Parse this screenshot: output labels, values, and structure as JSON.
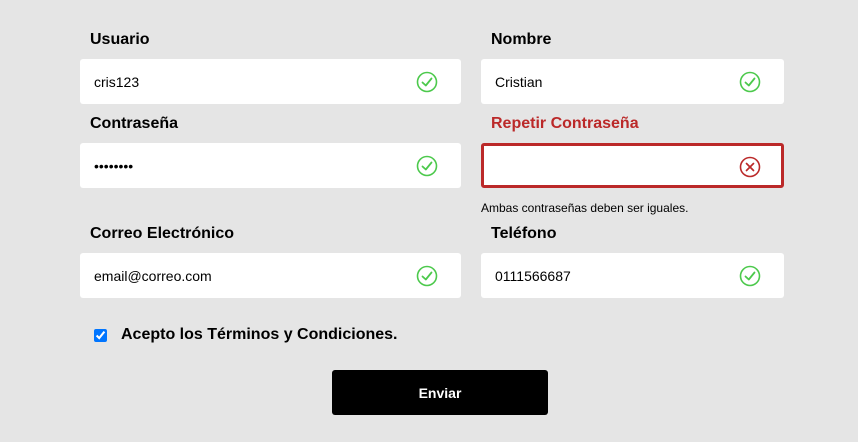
{
  "form": {
    "usuario": {
      "label": "Usuario",
      "value": "cris123",
      "status": "valid"
    },
    "nombre": {
      "label": "Nombre",
      "value": "Cristian",
      "status": "valid"
    },
    "password": {
      "label": "Contraseña",
      "value": "••••••••",
      "status": "valid"
    },
    "password2": {
      "label": "Repetir Contraseña",
      "value": "",
      "status": "invalid",
      "error": "Ambas contraseñas deben ser iguales."
    },
    "correo": {
      "label": "Correo Electrónico",
      "value": "email@correo.com",
      "status": "valid"
    },
    "telefono": {
      "label": "Teléfono",
      "value": "0111566687",
      "status": "valid"
    },
    "terms_label": "Acepto los Términos y Condiciones.",
    "terms_checked": true,
    "submit_label": "Enviar"
  },
  "colors": {
    "background": "#e5e5e5",
    "valid": "#4cc94c",
    "error": "#bb2929",
    "button": "#000000"
  },
  "icons": {
    "valid": "check-circle-icon",
    "invalid": "x-circle-icon"
  }
}
